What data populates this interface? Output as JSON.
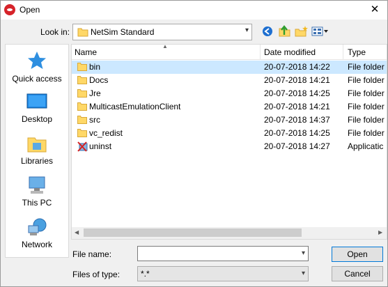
{
  "window": {
    "title": "Open",
    "close_glyph": "✕"
  },
  "toolbar": {
    "look_in_label": "Look in:",
    "look_in_value": "NetSim Standard",
    "buttons": [
      "back-icon",
      "up-folder-icon",
      "new-folder-icon",
      "view-menu-icon"
    ]
  },
  "places": [
    {
      "label": "Quick access",
      "icon": "star-icon"
    },
    {
      "label": "Desktop",
      "icon": "desktop-icon"
    },
    {
      "label": "Libraries",
      "icon": "libraries-icon"
    },
    {
      "label": "This PC",
      "icon": "computer-icon"
    },
    {
      "label": "Network",
      "icon": "network-icon"
    }
  ],
  "columns": {
    "name": "Name",
    "date": "Date modified",
    "type": "Type"
  },
  "files": [
    {
      "name": "bin",
      "date": "20-07-2018 14:22",
      "type": "File folder",
      "icon": "folder-icon",
      "selected": true
    },
    {
      "name": "Docs",
      "date": "20-07-2018 14:21",
      "type": "File folder",
      "icon": "folder-icon"
    },
    {
      "name": "Jre",
      "date": "20-07-2018 14:25",
      "type": "File folder",
      "icon": "folder-icon"
    },
    {
      "name": "MulticastEmulationClient",
      "date": "20-07-2018 14:21",
      "type": "File folder",
      "icon": "folder-icon"
    },
    {
      "name": "src",
      "date": "20-07-2018 14:37",
      "type": "File folder",
      "icon": "folder-icon"
    },
    {
      "name": "vc_redist",
      "date": "20-07-2018 14:25",
      "type": "File folder",
      "icon": "folder-icon"
    },
    {
      "name": "uninst",
      "date": "20-07-2018 14:27",
      "type": "Applicatic",
      "icon": "uninstall-app-icon"
    }
  ],
  "file_name": {
    "label": "File name:",
    "value": ""
  },
  "file_type": {
    "label": "Files of type:",
    "value": "*.*"
  },
  "buttons": {
    "open": "Open",
    "cancel": "Cancel"
  },
  "colors": {
    "selection": "#cce8ff",
    "folder": "#ffd867",
    "accent": "#0078d7"
  }
}
